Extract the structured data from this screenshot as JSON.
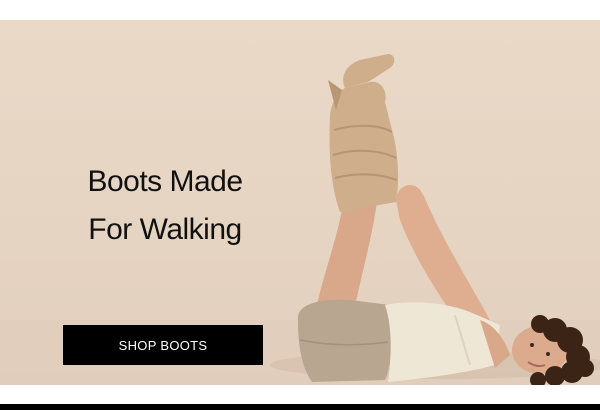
{
  "hero": {
    "headline_line1": "Boots Made",
    "headline_line2": "For Walking",
    "cta_label": "SHOP BOOTS",
    "image_alt": "Model lying on the floor wearing tan knee-high boots"
  },
  "colors": {
    "background": "#e8d7c6",
    "button": "#000000",
    "button_text": "#ffffff",
    "boot": "#cfae8c"
  }
}
